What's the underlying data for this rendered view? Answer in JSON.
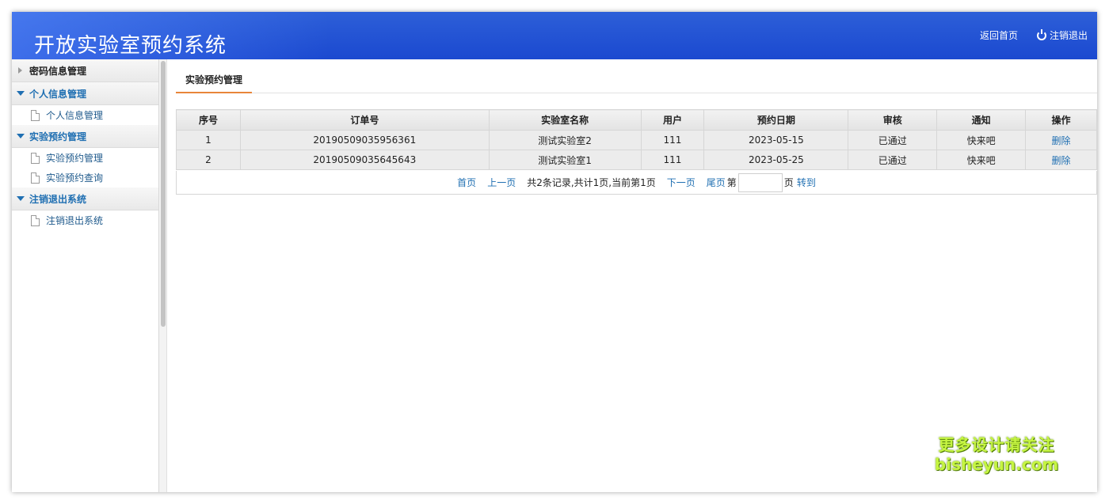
{
  "header": {
    "title": "开放实验室预约系统",
    "home_link": "返回首页",
    "logout_link": "注销退出"
  },
  "sidebar": {
    "groups": [
      {
        "label": "密码信息管理",
        "expanded": false,
        "items": []
      },
      {
        "label": "个人信息管理",
        "expanded": true,
        "items": [
          {
            "label": "个人信息管理"
          }
        ]
      },
      {
        "label": "实验预约管理",
        "expanded": true,
        "items": [
          {
            "label": "实验预约管理"
          },
          {
            "label": "实验预约查询"
          }
        ]
      },
      {
        "label": "注销退出系统",
        "expanded": true,
        "items": [
          {
            "label": "注销退出系统"
          }
        ]
      }
    ]
  },
  "main": {
    "tab": "实验预约管理",
    "table": {
      "headers": [
        "序号",
        "订单号",
        "实验室名称",
        "用户",
        "预约日期",
        "审核",
        "通知",
        "操作"
      ],
      "rows": [
        [
          "1",
          "20190509035956361",
          "测试实验室2",
          "111",
          "2023-05-15",
          "已通过",
          "快来吧",
          "删除"
        ],
        [
          "2",
          "20190509035645643",
          "测试实验室1",
          "111",
          "2023-05-25",
          "已通过",
          "快来吧",
          "删除"
        ]
      ]
    },
    "pager": {
      "first": "首页",
      "prev": "上一页",
      "summary": "共2条记录,共计1页,当前第1页",
      "next": "下一页",
      "last": "尾页",
      "goto_prefix": "第",
      "goto_suffix": "页",
      "goto_button": "转到"
    }
  },
  "watermark": {
    "line1": "更多设计请关注",
    "line2": "bisheyun.com"
  },
  "colors": {
    "header_blue": "#1b49d0",
    "link_blue": "#1f6fb2",
    "tab_accent": "#e8853a",
    "watermark_green": "#c6f542"
  }
}
